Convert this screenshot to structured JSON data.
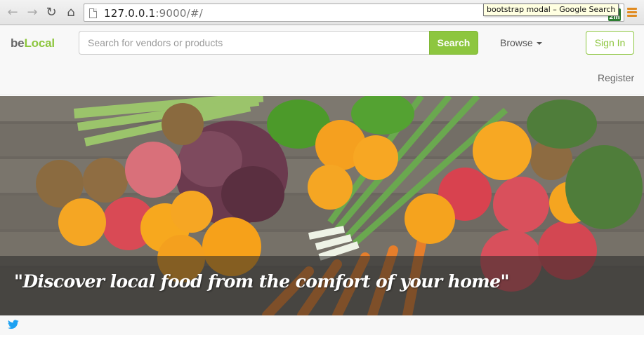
{
  "browser": {
    "url_host": "127.0.0.1",
    "url_rest": ":9000/#/",
    "tooltip": "bootstrap modal – Google Search",
    "ext_badge": "2m",
    "back_icon": "arrow-left-icon",
    "forward_icon": "arrow-right-icon",
    "reload_icon": "reload-icon",
    "home_icon": "home-icon"
  },
  "header": {
    "brand_prefix": "be",
    "brand_accent": "Local",
    "search_placeholder": "Search for vendors or products",
    "search_label": "Search",
    "browse_label": "Browse",
    "signin_label": "Sign In",
    "register_label": "Register"
  },
  "hero": {
    "caption": "\"Discover local food from the comfort of your home\""
  },
  "footer": {
    "twitter_icon": "twitter-icon"
  },
  "colors": {
    "accent": "#8dc63f",
    "header_bg": "#f8f8f8",
    "caption_overlay": "rgba(40,40,40,0.55)"
  }
}
